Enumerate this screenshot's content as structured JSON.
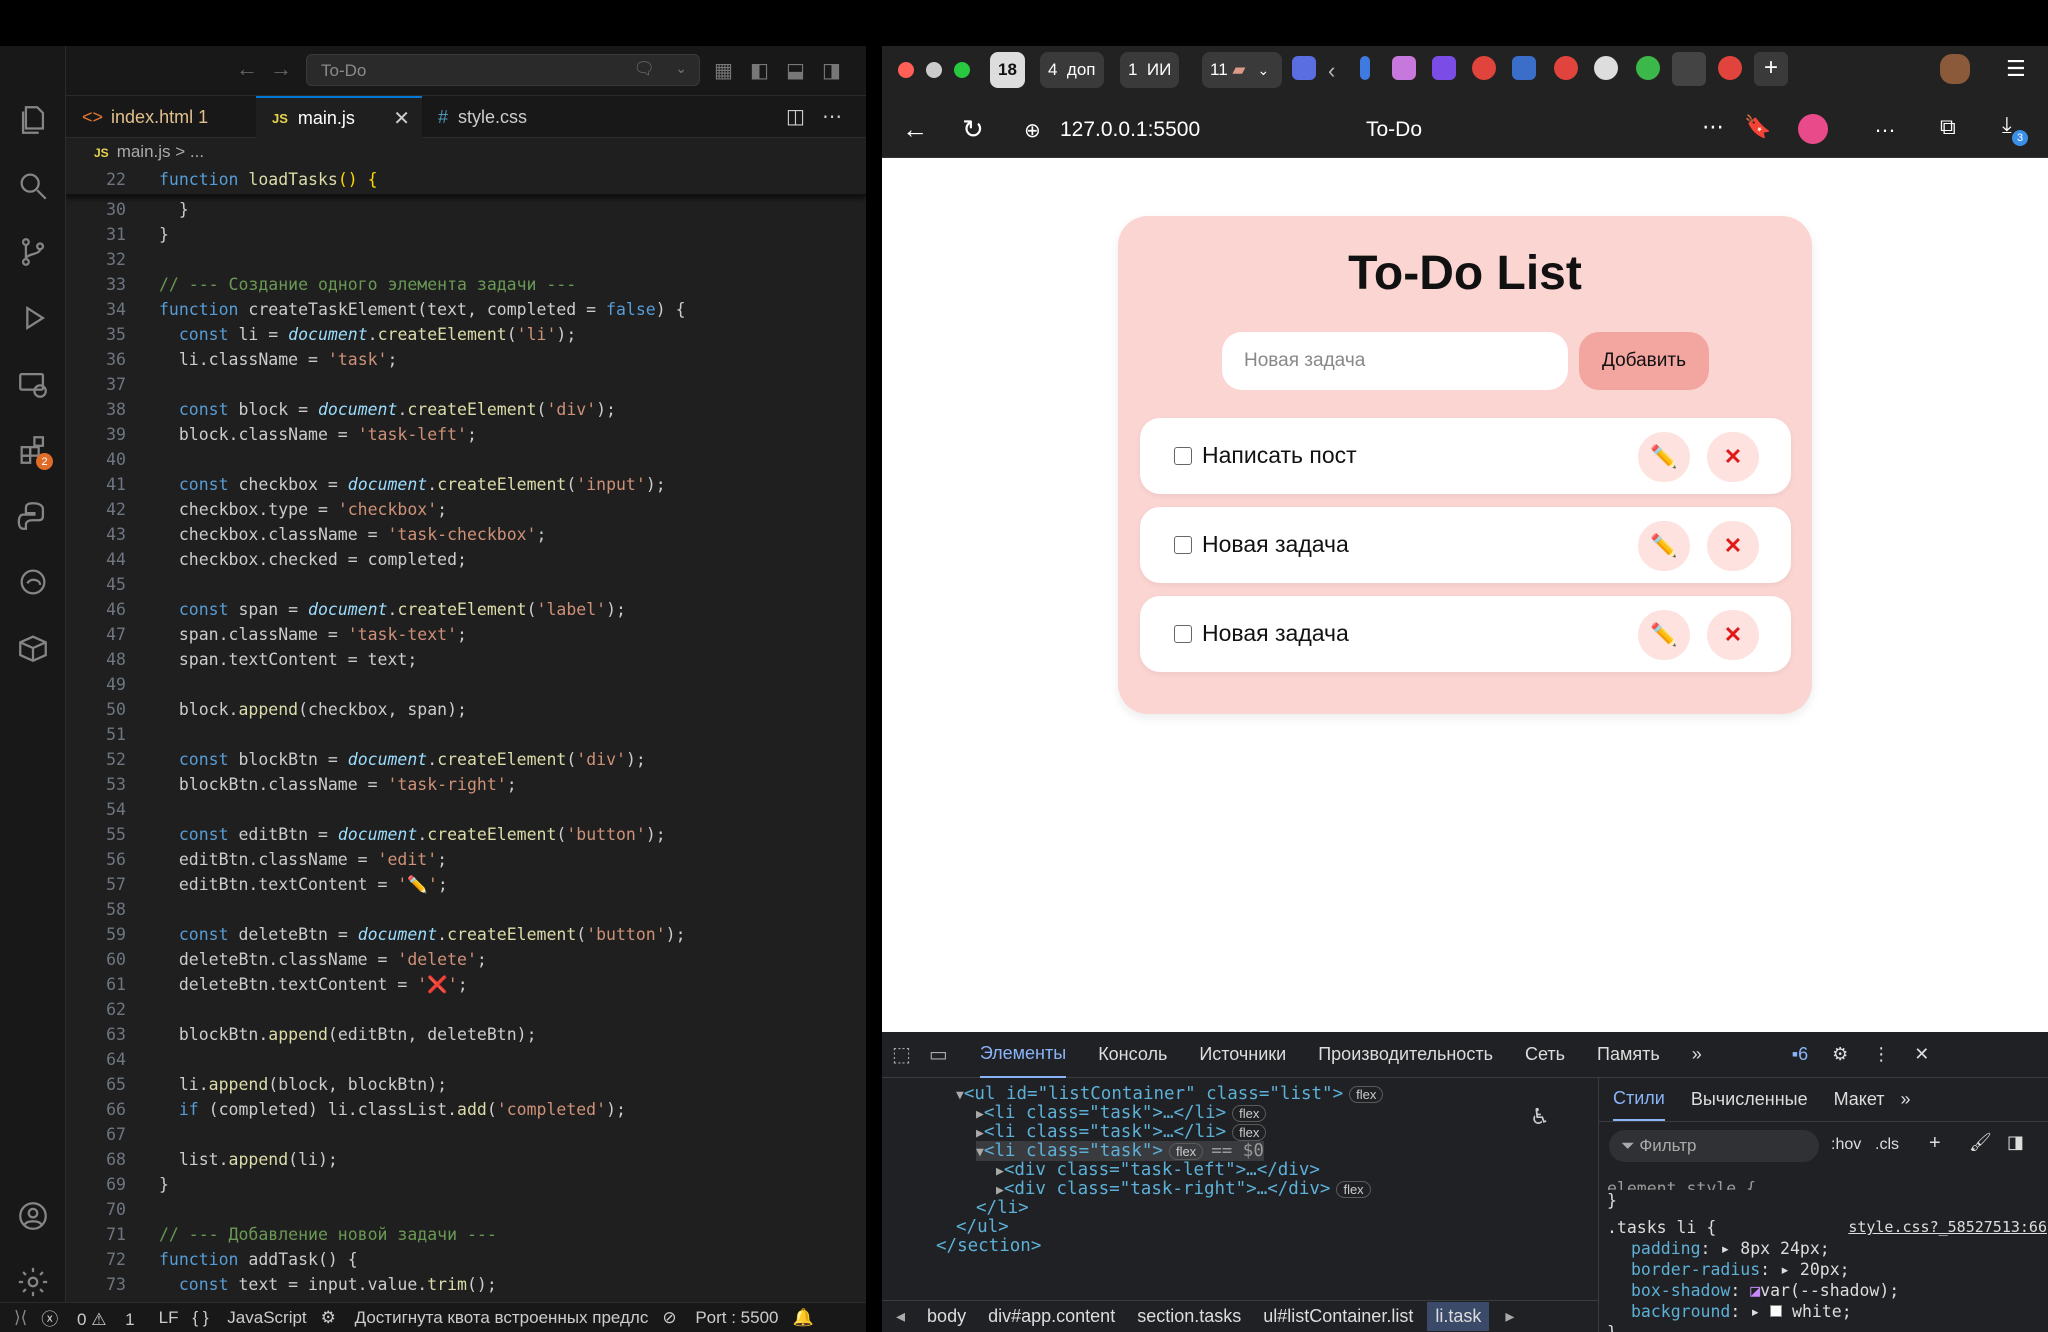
{
  "vscode": {
    "search_text": "To-Do",
    "tabs": [
      {
        "label": "index.html",
        "count": "1"
      },
      {
        "label": "main.js"
      },
      {
        "label": "style.css"
      }
    ],
    "breadcrumb": "main.js > ...",
    "extensions_badge": "2",
    "sticky": {
      "num": "22",
      "code": "function loadTasks() {"
    },
    "lines": [
      {
        "n": "30",
        "t": "  }"
      },
      {
        "n": "31",
        "t": "}"
      },
      {
        "n": "32",
        "t": ""
      },
      {
        "n": "33",
        "t": "// --- Создание одного элемента задачи ---"
      },
      {
        "n": "34",
        "t": "function createTaskElement(text, completed = false) {"
      },
      {
        "n": "35",
        "t": "  const li = document.createElement('li');"
      },
      {
        "n": "36",
        "t": "  li.className = 'task';"
      },
      {
        "n": "37",
        "t": ""
      },
      {
        "n": "38",
        "t": "  const block = document.createElement('div');"
      },
      {
        "n": "39",
        "t": "  block.className = 'task-left';"
      },
      {
        "n": "40",
        "t": ""
      },
      {
        "n": "41",
        "t": "  const checkbox = document.createElement('input');"
      },
      {
        "n": "42",
        "t": "  checkbox.type = 'checkbox';"
      },
      {
        "n": "43",
        "t": "  checkbox.className = 'task-checkbox';"
      },
      {
        "n": "44",
        "t": "  checkbox.checked = completed;"
      },
      {
        "n": "45",
        "t": ""
      },
      {
        "n": "46",
        "t": "  const span = document.createElement('label');"
      },
      {
        "n": "47",
        "t": "  span.className = 'task-text';"
      },
      {
        "n": "48",
        "t": "  span.textContent = text;"
      },
      {
        "n": "49",
        "t": ""
      },
      {
        "n": "50",
        "t": "  block.append(checkbox, span);"
      },
      {
        "n": "51",
        "t": ""
      },
      {
        "n": "52",
        "t": "  const blockBtn = document.createElement('div');"
      },
      {
        "n": "53",
        "t": "  blockBtn.className = 'task-right';"
      },
      {
        "n": "54",
        "t": ""
      },
      {
        "n": "55",
        "t": "  const editBtn = document.createElement('button');"
      },
      {
        "n": "56",
        "t": "  editBtn.className = 'edit';"
      },
      {
        "n": "57",
        "t": "  editBtn.textContent = '✏️';"
      },
      {
        "n": "58",
        "t": ""
      },
      {
        "n": "59",
        "t": "  const deleteBtn = document.createElement('button');"
      },
      {
        "n": "60",
        "t": "  deleteBtn.className = 'delete';"
      },
      {
        "n": "61",
        "t": "  deleteBtn.textContent = '❌';"
      },
      {
        "n": "62",
        "t": ""
      },
      {
        "n": "63",
        "t": "  blockBtn.append(editBtn, deleteBtn);"
      },
      {
        "n": "64",
        "t": ""
      },
      {
        "n": "65",
        "t": "  li.append(block, blockBtn);"
      },
      {
        "n": "66",
        "t": "  if (completed) li.classList.add('completed');"
      },
      {
        "n": "67",
        "t": ""
      },
      {
        "n": "68",
        "t": "  list.append(li);"
      },
      {
        "n": "69",
        "t": "}"
      },
      {
        "n": "70",
        "t": ""
      },
      {
        "n": "71",
        "t": "// --- Добавление новой задачи ---"
      },
      {
        "n": "72",
        "t": "function addTask() {"
      },
      {
        "n": "73",
        "t": "  const text = input.value.trim();"
      }
    ],
    "status": {
      "errors": "0",
      "warnings": "1",
      "eol": "LF",
      "language": "JavaScript",
      "message": "Достигнута квота встроенных предлс",
      "port": "Port : 5500"
    }
  },
  "browser": {
    "tab_count": "18",
    "tab_groups": [
      {
        "n": "4",
        "l": "доп"
      },
      {
        "n": "1",
        "l": "ИИ"
      },
      {
        "n": "11",
        "l": ""
      }
    ],
    "url": "127.0.0.1:5500",
    "page_title": "To-Do",
    "downloads_badge": "3",
    "app": {
      "title": "To-Do List",
      "input_placeholder": "Новая задача",
      "add_label": "Добавить",
      "tasks": [
        {
          "text": "Написать пост",
          "edit": "✏️",
          "delete": "✕"
        },
        {
          "text": "Новая задача",
          "edit": "✏️",
          "delete": "✕"
        },
        {
          "text": "Новая задача",
          "edit": "✏️",
          "delete": "✕"
        }
      ]
    },
    "devtools": {
      "tabs": [
        "Элементы",
        "Консоль",
        "Источники",
        "Производительность",
        "Сеть",
        "Память"
      ],
      "messages": "6",
      "dom": [
        {
          "i": 0,
          "tri": "▼",
          "h": "<ul id=\"listContainer\" class=\"list\">",
          "f": "flex"
        },
        {
          "i": 1,
          "tri": "▶",
          "h": "<li class=\"task\">…</li>",
          "f": "flex"
        },
        {
          "i": 1,
          "tri": "▶",
          "h": "<li class=\"task\">…</li>",
          "f": "flex"
        },
        {
          "i": 1,
          "tri": "▼",
          "h": "<li class=\"task\">",
          "f": "flex",
          "sel": "== $0"
        },
        {
          "i": 2,
          "tri": "▶",
          "h": "<div class=\"task-left\">…</div>",
          "f": ""
        },
        {
          "i": 2,
          "tri": "▶",
          "h": "<div class=\"task-right\">…</div>",
          "f": "flex"
        },
        {
          "i": 1,
          "tri": "",
          "h": "</li>",
          "f": ""
        },
        {
          "i": 0,
          "tri": "",
          "h": "</ul>",
          "f": ""
        },
        {
          "i": -1,
          "tri": "",
          "h": "</section>",
          "f": ""
        }
      ],
      "style_tabs": [
        "Стили",
        "Вычисленные",
        "Макет"
      ],
      "filter_placeholder": "Фильтр",
      "hov": ":hov",
      "cls": ".cls",
      "element_style": "element.style {",
      "rule_selector": ".tasks li {",
      "rule_source": "style.css?_58527513:66",
      "props": [
        {
          "k": "padding",
          "v": "8px 24px;"
        },
        {
          "k": "border-radius",
          "v": "20px;"
        },
        {
          "k": "box-shadow",
          "v": "var(--shadow);"
        },
        {
          "k": "background",
          "v": "white;"
        }
      ],
      "crumbs": [
        "body",
        "div#app.content",
        "section.tasks",
        "ul#listContainer.list",
        "li.task"
      ]
    }
  },
  "colors": {
    "card": "#fbd5d1",
    "add_button": "#f3a5a0",
    "delete": "#e01818"
  }
}
